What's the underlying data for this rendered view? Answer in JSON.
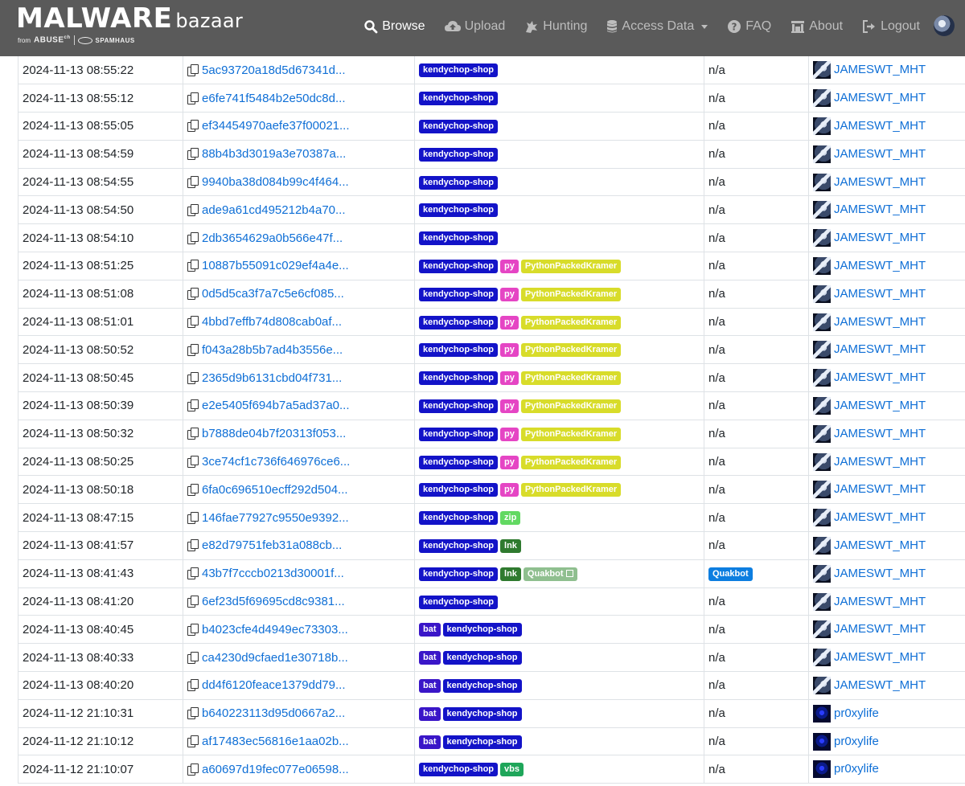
{
  "brand": {
    "main": "MALWARE",
    "sub": "bazaar",
    "from": "from",
    "abuse": "ABUSE",
    "abuse_sup": "ch",
    "spamhaus": "SPAMHAUS"
  },
  "nav": {
    "browse": "Browse",
    "upload": "Upload",
    "hunting": "Hunting",
    "access_data": "Access Data",
    "faq": "FAQ",
    "about": "About",
    "logout": "Logout"
  },
  "colors": {
    "navbar": "#5a5a5a",
    "link": "#0f6fd6",
    "tag_kendychop": "#1313c8",
    "tag_py": "#e545c4",
    "tag_pythonpackedkramer": "#d8dc2a",
    "tag_zip": "#62d962",
    "tag_lnk": "#2f7a2f",
    "tag_quakbot_light": "#8fbf8f",
    "tag_bat": "#3a16c8",
    "tag_vbs": "#1fa65a",
    "sig_quakbot": "#0d7ee0"
  },
  "rows": [
    {
      "date": "2024-11-13 08:55:22",
      "hash": "5ac93720a18d5d67341d...",
      "tags": [
        {
          "t": "kendychop-shop",
          "c": "kendy"
        }
      ],
      "signature": "n/a",
      "reporter": "JAMESWT_MHT",
      "av": "james"
    },
    {
      "date": "2024-11-13 08:55:12",
      "hash": "e6fe741f5484b2e50dc8d...",
      "tags": [
        {
          "t": "kendychop-shop",
          "c": "kendy"
        }
      ],
      "signature": "n/a",
      "reporter": "JAMESWT_MHT",
      "av": "james"
    },
    {
      "date": "2024-11-13 08:55:05",
      "hash": "ef34454970aefe37f00021...",
      "tags": [
        {
          "t": "kendychop-shop",
          "c": "kendy"
        }
      ],
      "signature": "n/a",
      "reporter": "JAMESWT_MHT",
      "av": "james"
    },
    {
      "date": "2024-11-13 08:54:59",
      "hash": "88b4b3d3019a3e70387a...",
      "tags": [
        {
          "t": "kendychop-shop",
          "c": "kendy"
        }
      ],
      "signature": "n/a",
      "reporter": "JAMESWT_MHT",
      "av": "james"
    },
    {
      "date": "2024-11-13 08:54:55",
      "hash": "9940ba38d084b99c4f464...",
      "tags": [
        {
          "t": "kendychop-shop",
          "c": "kendy"
        }
      ],
      "signature": "n/a",
      "reporter": "JAMESWT_MHT",
      "av": "james"
    },
    {
      "date": "2024-11-13 08:54:50",
      "hash": "ade9a61cd495212b4a70...",
      "tags": [
        {
          "t": "kendychop-shop",
          "c": "kendy"
        }
      ],
      "signature": "n/a",
      "reporter": "JAMESWT_MHT",
      "av": "james"
    },
    {
      "date": "2024-11-13 08:54:10",
      "hash": "2db3654629a0b566e47f...",
      "tags": [
        {
          "t": "kendychop-shop",
          "c": "kendy"
        }
      ],
      "signature": "n/a",
      "reporter": "JAMESWT_MHT",
      "av": "james"
    },
    {
      "date": "2024-11-13 08:51:25",
      "hash": "10887b55091c029ef4a4e...",
      "tags": [
        {
          "t": "kendychop-shop",
          "c": "kendy"
        },
        {
          "t": "py",
          "c": "py"
        },
        {
          "t": "PythonPackedKramer",
          "c": "ppk"
        }
      ],
      "signature": "n/a",
      "reporter": "JAMESWT_MHT",
      "av": "james"
    },
    {
      "date": "2024-11-13 08:51:08",
      "hash": "0d5d5ca3f7a7c5e6cf085...",
      "tags": [
        {
          "t": "kendychop-shop",
          "c": "kendy"
        },
        {
          "t": "py",
          "c": "py"
        },
        {
          "t": "PythonPackedKramer",
          "c": "ppk"
        }
      ],
      "signature": "n/a",
      "reporter": "JAMESWT_MHT",
      "av": "james"
    },
    {
      "date": "2024-11-13 08:51:01",
      "hash": "4bbd7effb74d808cab0af...",
      "tags": [
        {
          "t": "kendychop-shop",
          "c": "kendy"
        },
        {
          "t": "py",
          "c": "py"
        },
        {
          "t": "PythonPackedKramer",
          "c": "ppk"
        }
      ],
      "signature": "n/a",
      "reporter": "JAMESWT_MHT",
      "av": "james"
    },
    {
      "date": "2024-11-13 08:50:52",
      "hash": "f043a28b5b7ad4b3556e...",
      "tags": [
        {
          "t": "kendychop-shop",
          "c": "kendy"
        },
        {
          "t": "py",
          "c": "py"
        },
        {
          "t": "PythonPackedKramer",
          "c": "ppk"
        }
      ],
      "signature": "n/a",
      "reporter": "JAMESWT_MHT",
      "av": "james"
    },
    {
      "date": "2024-11-13 08:50:45",
      "hash": "2365d9b6131cbd04f731...",
      "tags": [
        {
          "t": "kendychop-shop",
          "c": "kendy"
        },
        {
          "t": "py",
          "c": "py"
        },
        {
          "t": "PythonPackedKramer",
          "c": "ppk"
        }
      ],
      "signature": "n/a",
      "reporter": "JAMESWT_MHT",
      "av": "james"
    },
    {
      "date": "2024-11-13 08:50:39",
      "hash": "e2e5405f694b7a5ad37a0...",
      "tags": [
        {
          "t": "kendychop-shop",
          "c": "kendy"
        },
        {
          "t": "py",
          "c": "py"
        },
        {
          "t": "PythonPackedKramer",
          "c": "ppk"
        }
      ],
      "signature": "n/a",
      "reporter": "JAMESWT_MHT",
      "av": "james"
    },
    {
      "date": "2024-11-13 08:50:32",
      "hash": "b7888de04b7f20313f053...",
      "tags": [
        {
          "t": "kendychop-shop",
          "c": "kendy"
        },
        {
          "t": "py",
          "c": "py"
        },
        {
          "t": "PythonPackedKramer",
          "c": "ppk"
        }
      ],
      "signature": "n/a",
      "reporter": "JAMESWT_MHT",
      "av": "james"
    },
    {
      "date": "2024-11-13 08:50:25",
      "hash": "3ce74cf1c736f646976ce6...",
      "tags": [
        {
          "t": "kendychop-shop",
          "c": "kendy"
        },
        {
          "t": "py",
          "c": "py"
        },
        {
          "t": "PythonPackedKramer",
          "c": "ppk"
        }
      ],
      "signature": "n/a",
      "reporter": "JAMESWT_MHT",
      "av": "james"
    },
    {
      "date": "2024-11-13 08:50:18",
      "hash": "6fa0c696510ecff292d504...",
      "tags": [
        {
          "t": "kendychop-shop",
          "c": "kendy"
        },
        {
          "t": "py",
          "c": "py"
        },
        {
          "t": "PythonPackedKramer",
          "c": "ppk"
        }
      ],
      "signature": "n/a",
      "reporter": "JAMESWT_MHT",
      "av": "james"
    },
    {
      "date": "2024-11-13 08:47:15",
      "hash": "146fae77927c9550e9392...",
      "tags": [
        {
          "t": "kendychop-shop",
          "c": "kendy"
        },
        {
          "t": "zip",
          "c": "zip"
        }
      ],
      "signature": "n/a",
      "reporter": "JAMESWT_MHT",
      "av": "james"
    },
    {
      "date": "2024-11-13 08:41:57",
      "hash": "e82d79751feb31a088cb...",
      "tags": [
        {
          "t": "kendychop-shop",
          "c": "kendy"
        },
        {
          "t": "lnk",
          "c": "lnk"
        }
      ],
      "signature": "n/a",
      "reporter": "JAMESWT_MHT",
      "av": "james"
    },
    {
      "date": "2024-11-13 08:41:43",
      "hash": "43b7f7cccb0213d30001f...",
      "tags": [
        {
          "t": "kendychop-shop",
          "c": "kendy"
        },
        {
          "t": "lnk",
          "c": "lnk"
        },
        {
          "t": "Quakbot",
          "c": "qbot",
          "ext": true
        }
      ],
      "signature": "Quakbot",
      "sigtag": true,
      "reporter": "JAMESWT_MHT",
      "av": "james"
    },
    {
      "date": "2024-11-13 08:41:20",
      "hash": "6ef23d5f69695cd8c9381...",
      "tags": [
        {
          "t": "kendychop-shop",
          "c": "kendy"
        }
      ],
      "signature": "n/a",
      "reporter": "JAMESWT_MHT",
      "av": "james"
    },
    {
      "date": "2024-11-13 08:40:45",
      "hash": "b4023cfe4d4949ec73303...",
      "tags": [
        {
          "t": "bat",
          "c": "bat"
        },
        {
          "t": "kendychop-shop",
          "c": "kendy"
        }
      ],
      "signature": "n/a",
      "reporter": "JAMESWT_MHT",
      "av": "james"
    },
    {
      "date": "2024-11-13 08:40:33",
      "hash": "ca4230d9cfaed1e30718b...",
      "tags": [
        {
          "t": "bat",
          "c": "bat"
        },
        {
          "t": "kendychop-shop",
          "c": "kendy"
        }
      ],
      "signature": "n/a",
      "reporter": "JAMESWT_MHT",
      "av": "james"
    },
    {
      "date": "2024-11-13 08:40:20",
      "hash": "dd4f6120feace1379dd79...",
      "tags": [
        {
          "t": "bat",
          "c": "bat"
        },
        {
          "t": "kendychop-shop",
          "c": "kendy"
        }
      ],
      "signature": "n/a",
      "reporter": "JAMESWT_MHT",
      "av": "james"
    },
    {
      "date": "2024-11-12 21:10:31",
      "hash": "b640223113d95d0667a2...",
      "tags": [
        {
          "t": "bat",
          "c": "bat"
        },
        {
          "t": "kendychop-shop",
          "c": "kendy"
        }
      ],
      "signature": "n/a",
      "reporter": "pr0xylife",
      "av": "proxy"
    },
    {
      "date": "2024-11-12 21:10:12",
      "hash": "af17483ec56816e1aa02b...",
      "tags": [
        {
          "t": "bat",
          "c": "bat"
        },
        {
          "t": "kendychop-shop",
          "c": "kendy"
        }
      ],
      "signature": "n/a",
      "reporter": "pr0xylife",
      "av": "proxy"
    },
    {
      "date": "2024-11-12 21:10:07",
      "hash": "a60697d19fec077e06598...",
      "tags": [
        {
          "t": "kendychop-shop",
          "c": "kendy"
        },
        {
          "t": "vbs",
          "c": "vbs"
        }
      ],
      "signature": "n/a",
      "reporter": "pr0xylife",
      "av": "proxy"
    }
  ]
}
